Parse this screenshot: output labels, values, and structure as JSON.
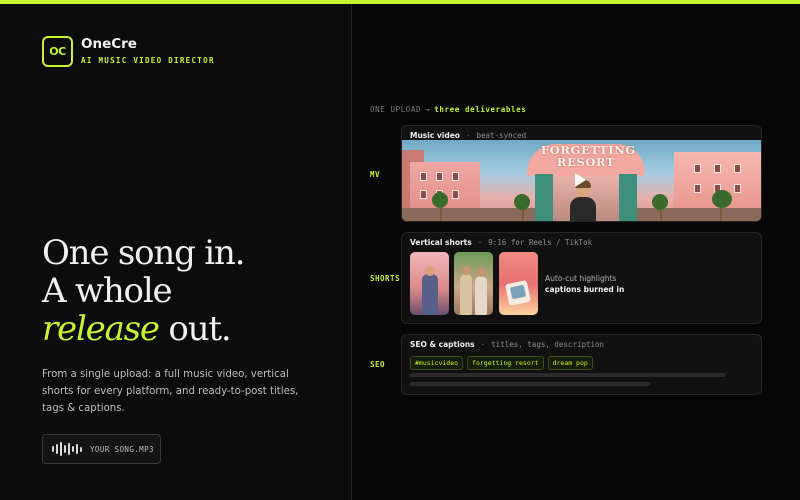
{
  "brand": {
    "logo_text": "OC",
    "name": "OneCre",
    "tagline": "AI MUSIC VIDEO DIRECTOR"
  },
  "hero": {
    "line1": "One song in.",
    "line2": "A whole",
    "line3_accent": "release",
    "line3_rest": " out.",
    "description": "From a single upload: a full music video, vertical shorts for every platform, and ready-to-post titles, tags & captions."
  },
  "upload": {
    "label": "YOUR SONG.MP3",
    "icon": "waveform-icon"
  },
  "flow": {
    "from": "ONE UPLOAD",
    "arrow": "→",
    "to": "three deliverables"
  },
  "deliverables": {
    "mv": {
      "label": "MV",
      "title": "Music video",
      "sep": "·",
      "subtitle": "beat-synced",
      "scene_sign": "FORGETTING RESORT",
      "play_icon": "play-icon"
    },
    "shorts": {
      "label": "SHORTS",
      "title": "Vertical shorts",
      "sep": "·",
      "subtitle": "9:16 for Reels / TikTok",
      "highlight_line1": "Auto-cut highlights",
      "highlight_line2": "captions burned in"
    },
    "seo": {
      "label": "SEO",
      "title": "SEO & captions",
      "sep": "·",
      "subtitle": "titles, tags, description",
      "tags": [
        "#musicvideo",
        "forgetting resort",
        "dream pop"
      ]
    }
  },
  "colors": {
    "accent": "#c6f432",
    "background": "#0b0b0b",
    "card": "#111111"
  }
}
